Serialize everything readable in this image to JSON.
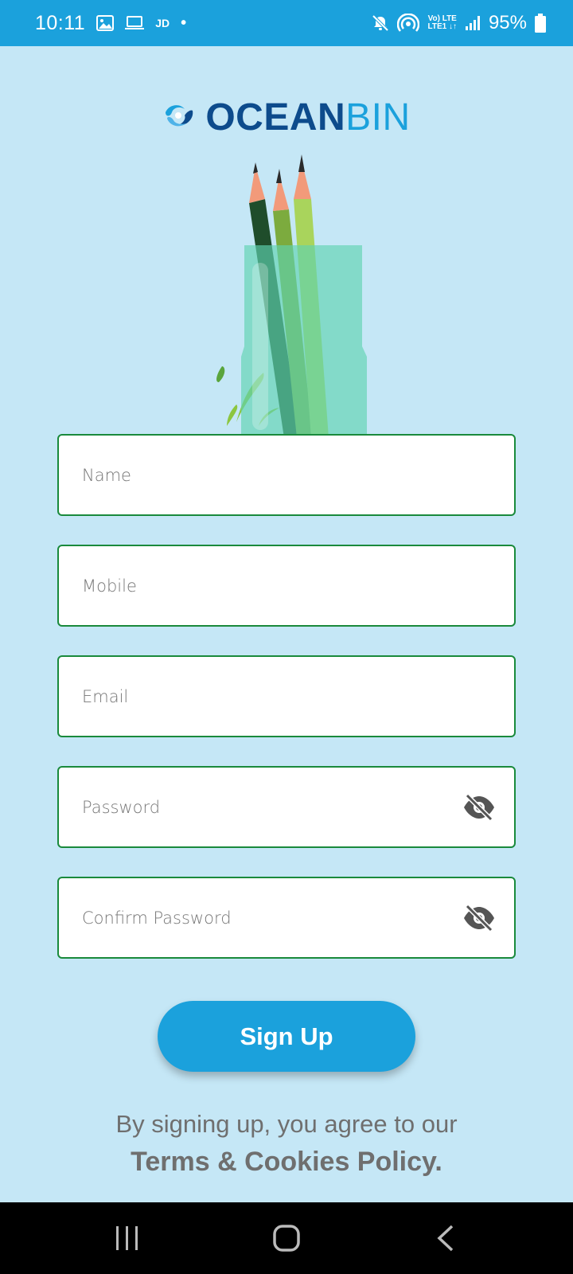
{
  "status_bar": {
    "time": "10:11",
    "carrier_tag": "JD",
    "dot": "•",
    "net_line1": "Vo) LTE",
    "net_line2": "LTE1 ↓↑",
    "battery": "95%"
  },
  "logo": {
    "part1": "OCEAN",
    "part2": "BIN"
  },
  "form": {
    "name_placeholder": "Name",
    "mobile_placeholder": "Mobile",
    "email_placeholder": "Email",
    "password_placeholder": "Password",
    "confirm_password_placeholder": "Confirm Password"
  },
  "signup_label": "Sign Up",
  "terms": {
    "line1": "By signing up, you agree to our",
    "link": "Terms & Cookies Policy."
  },
  "colors": {
    "status_bar": "#1ba1dc",
    "background": "#c5e7f6",
    "field_border": "#1a8a3c",
    "button": "#1ba1dc",
    "logo_dark": "#0d4b8c"
  },
  "icons": [
    "image-icon",
    "laptop-icon",
    "mute-icon",
    "hotspot-icon",
    "signal-icon",
    "battery-icon",
    "eye-off-icon",
    "recent-apps-icon",
    "home-icon",
    "back-icon"
  ]
}
